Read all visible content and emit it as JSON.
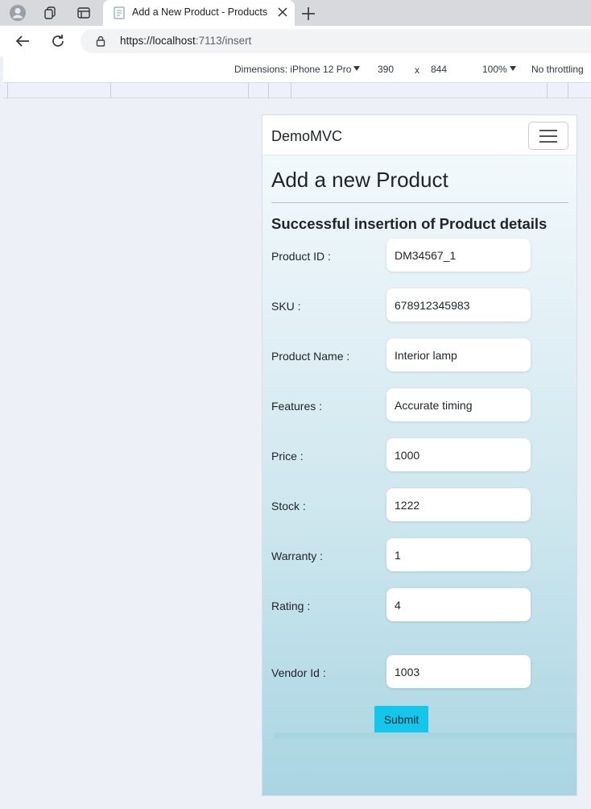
{
  "browser": {
    "tab_title": "Add a New Product - Products",
    "url_host": "https://localhost",
    "url_rest": ":7113/insert"
  },
  "devtools": {
    "dimensions_label": "Dimensions: iPhone 12 Pro",
    "width": "390",
    "times": "x",
    "height": "844",
    "zoom": "100%",
    "throttling": "No throttling"
  },
  "navbar": {
    "brand": "DemoMVC"
  },
  "main": {
    "title": "Add a new Product",
    "status": "Successful insertion of Product details",
    "fields": [
      {
        "label": "Product ID :",
        "value": "DM34567_1"
      },
      {
        "label": "SKU :",
        "value": "678912345983"
      },
      {
        "label": "Product Name :",
        "value": "Interior lamp"
      },
      {
        "label": "Features :",
        "value": "Accurate timing"
      },
      {
        "label": "Price :",
        "value": "1000"
      },
      {
        "label": "Stock :",
        "value": "1222"
      },
      {
        "label": "Warranty :",
        "value": "1"
      },
      {
        "label": "Rating :",
        "value": "4"
      },
      {
        "label": "Vendor Id :",
        "value": "1003"
      }
    ],
    "submit_label": "Submit"
  },
  "colors": {
    "submit": "#13c6ea",
    "device_gradient_top": "#f6fbfd",
    "device_gradient_bottom": "#a9d5e2"
  }
}
